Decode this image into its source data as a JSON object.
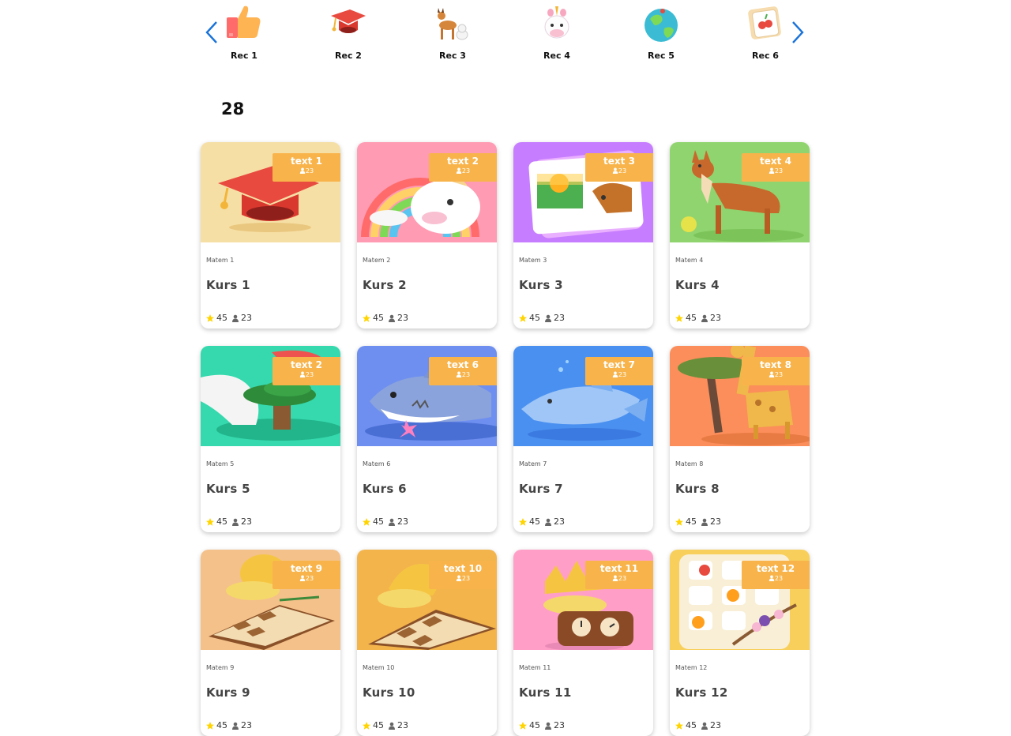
{
  "carousel": {
    "items": [
      {
        "label": "Rec 1",
        "icon": "thumbs-up-icon"
      },
      {
        "label": "Rec 2",
        "icon": "graduation-cap-icon"
      },
      {
        "label": "Rec 3",
        "icon": "deer-cat-icon"
      },
      {
        "label": "Rec 4",
        "icon": "unicorn-icon"
      },
      {
        "label": "Rec 5",
        "icon": "globe-icon"
      },
      {
        "label": "Rec 6",
        "icon": "fruit-cards-icon"
      }
    ]
  },
  "results": {
    "count": "28"
  },
  "cards": [
    {
      "badge": "text 1",
      "badge_count": "23",
      "subject": "Matem 1",
      "title": "Kurs 1",
      "rating": "45",
      "users": "23",
      "image": "graduation-cap",
      "bg": "#f6dfa5"
    },
    {
      "badge": "text 2",
      "badge_count": "23",
      "subject": "Matem 2",
      "title": "Kurs 2",
      "rating": "45",
      "users": "23",
      "image": "unicorn-rainbow",
      "bg": "#ff9bb3"
    },
    {
      "badge": "text 3",
      "badge_count": "23",
      "subject": "Matem 3",
      "title": "Kurs 3",
      "rating": "45",
      "users": "23",
      "image": "picture-cards",
      "bg": "#c77dff"
    },
    {
      "badge": "text 4",
      "badge_count": "23",
      "subject": "Matem 4",
      "title": "Kurs 4",
      "rating": "45",
      "users": "23",
      "image": "dingo",
      "bg": "#90d46f"
    },
    {
      "badge": "text 2",
      "badge_count": "23",
      "subject": "Matem 5",
      "title": "Kurs 5",
      "rating": "45",
      "users": "23",
      "image": "tree-flag",
      "bg": "#35d9ad"
    },
    {
      "badge": "text 6",
      "badge_count": "23",
      "subject": "Matem 6",
      "title": "Kurs 6",
      "rating": "45",
      "users": "23",
      "image": "shark",
      "bg": "#6e8ff0"
    },
    {
      "badge": "text 7",
      "badge_count": "23",
      "subject": "Matem 7",
      "title": "Kurs 7",
      "rating": "45",
      "users": "23",
      "image": "dolphin",
      "bg": "#4a90f0"
    },
    {
      "badge": "text 8",
      "badge_count": "23",
      "subject": "Matem 8",
      "title": "Kurs 8",
      "rating": "45",
      "users": "23",
      "image": "giraffe",
      "bg": "#fb8e5a"
    },
    {
      "badge": "text 9",
      "badge_count": "23",
      "subject": "Matem 9",
      "title": "Kurs 9",
      "rating": "45",
      "users": "23",
      "image": "chess-bell",
      "bg": "#f4c18a"
    },
    {
      "badge": "text 10",
      "badge_count": "23",
      "subject": "Matem 10",
      "title": "Kurs 10",
      "rating": "45",
      "users": "23",
      "image": "chess-knight",
      "bg": "#f3b44c"
    },
    {
      "badge": "text 11",
      "badge_count": "23",
      "subject": "Matem 11",
      "title": "Kurs 11",
      "rating": "45",
      "users": "23",
      "image": "crown-clock",
      "bg": "#ff9fc8"
    },
    {
      "badge": "text 12",
      "badge_count": "23",
      "subject": "Matem 12",
      "title": "Kurs 12",
      "rating": "45",
      "users": "23",
      "image": "fruit-board",
      "bg": "#f7cf5a"
    }
  ],
  "colors": {
    "badge": "#f8b44b",
    "arrow": "#1a73d9",
    "star": "#ffd400"
  }
}
